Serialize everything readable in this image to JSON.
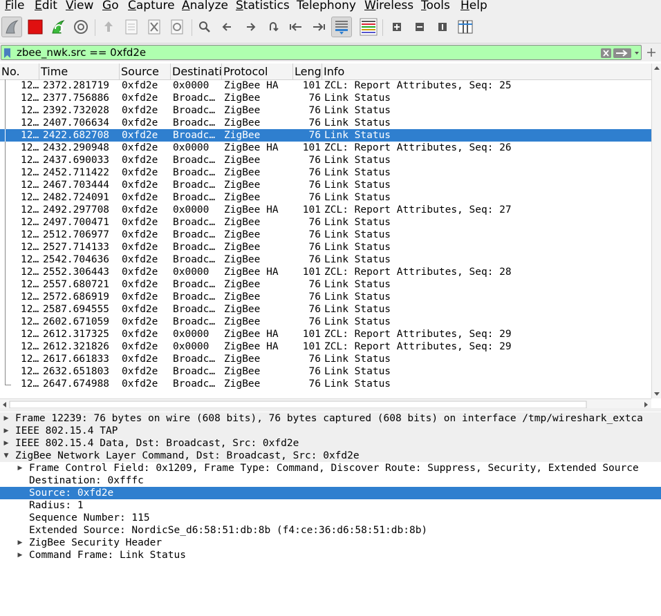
{
  "menu": [
    {
      "label": "File",
      "u": "F",
      "rest": "ile"
    },
    {
      "label": "Edit",
      "u": "E",
      "rest": "dit"
    },
    {
      "label": "View",
      "u": "V",
      "rest": "iew"
    },
    {
      "label": "Go",
      "u": "G",
      "rest": "o"
    },
    {
      "label": "Capture",
      "u": "C",
      "rest": "apture"
    },
    {
      "label": "Analyze",
      "u": "A",
      "rest": "nalyze"
    },
    {
      "label": "Statistics",
      "u": "S",
      "rest": "tatistics"
    },
    {
      "label": "Telephony",
      "u": "",
      "rest": "Telephony"
    },
    {
      "label": "Wireless",
      "u": "W",
      "rest": "ireless"
    },
    {
      "label": "Tools",
      "u": "T",
      "rest": "ools"
    },
    {
      "label": "Help",
      "u": "H",
      "rest": "elp"
    }
  ],
  "filter": {
    "value": "zbee_nwk.src == 0xfd2e"
  },
  "columns": {
    "no": "No.",
    "time": "Time",
    "source": "Source",
    "destination": "Destinati",
    "protocol": "Protocol",
    "length": "Leng",
    "info": "Info"
  },
  "packets": [
    {
      "no": "12…",
      "time": "2372.281719",
      "src": "0xfd2e",
      "dst": "0x0000",
      "proto": "ZigBee HA",
      "len": "101",
      "info": "ZCL: Report Attributes, Seq: 25"
    },
    {
      "no": "12…",
      "time": "2377.756886",
      "src": "0xfd2e",
      "dst": "Broadc…",
      "proto": "ZigBee",
      "len": "76",
      "info": "Link Status"
    },
    {
      "no": "12…",
      "time": "2392.732028",
      "src": "0xfd2e",
      "dst": "Broadc…",
      "proto": "ZigBee",
      "len": "76",
      "info": "Link Status"
    },
    {
      "no": "12…",
      "time": "2407.706634",
      "src": "0xfd2e",
      "dst": "Broadc…",
      "proto": "ZigBee",
      "len": "76",
      "info": "Link Status"
    },
    {
      "no": "12…",
      "time": "2422.682708",
      "src": "0xfd2e",
      "dst": "Broadc…",
      "proto": "ZigBee",
      "len": "76",
      "info": "Link Status",
      "selected": true
    },
    {
      "no": "12…",
      "time": "2432.290948",
      "src": "0xfd2e",
      "dst": "0x0000",
      "proto": "ZigBee HA",
      "len": "101",
      "info": "ZCL: Report Attributes, Seq: 26"
    },
    {
      "no": "12…",
      "time": "2437.690033",
      "src": "0xfd2e",
      "dst": "Broadc…",
      "proto": "ZigBee",
      "len": "76",
      "info": "Link Status"
    },
    {
      "no": "12…",
      "time": "2452.711422",
      "src": "0xfd2e",
      "dst": "Broadc…",
      "proto": "ZigBee",
      "len": "76",
      "info": "Link Status"
    },
    {
      "no": "12…",
      "time": "2467.703444",
      "src": "0xfd2e",
      "dst": "Broadc…",
      "proto": "ZigBee",
      "len": "76",
      "info": "Link Status"
    },
    {
      "no": "12…",
      "time": "2482.724091",
      "src": "0xfd2e",
      "dst": "Broadc…",
      "proto": "ZigBee",
      "len": "76",
      "info": "Link Status"
    },
    {
      "no": "12…",
      "time": "2492.297708",
      "src": "0xfd2e",
      "dst": "0x0000",
      "proto": "ZigBee HA",
      "len": "101",
      "info": "ZCL: Report Attributes, Seq: 27"
    },
    {
      "no": "12…",
      "time": "2497.700471",
      "src": "0xfd2e",
      "dst": "Broadc…",
      "proto": "ZigBee",
      "len": "76",
      "info": "Link Status"
    },
    {
      "no": "12…",
      "time": "2512.706977",
      "src": "0xfd2e",
      "dst": "Broadc…",
      "proto": "ZigBee",
      "len": "76",
      "info": "Link Status"
    },
    {
      "no": "12…",
      "time": "2527.714133",
      "src": "0xfd2e",
      "dst": "Broadc…",
      "proto": "ZigBee",
      "len": "76",
      "info": "Link Status"
    },
    {
      "no": "12…",
      "time": "2542.704636",
      "src": "0xfd2e",
      "dst": "Broadc…",
      "proto": "ZigBee",
      "len": "76",
      "info": "Link Status"
    },
    {
      "no": "12…",
      "time": "2552.306443",
      "src": "0xfd2e",
      "dst": "0x0000",
      "proto": "ZigBee HA",
      "len": "101",
      "info": "ZCL: Report Attributes, Seq: 28"
    },
    {
      "no": "12…",
      "time": "2557.680721",
      "src": "0xfd2e",
      "dst": "Broadc…",
      "proto": "ZigBee",
      "len": "76",
      "info": "Link Status"
    },
    {
      "no": "12…",
      "time": "2572.686919",
      "src": "0xfd2e",
      "dst": "Broadc…",
      "proto": "ZigBee",
      "len": "76",
      "info": "Link Status"
    },
    {
      "no": "12…",
      "time": "2587.694555",
      "src": "0xfd2e",
      "dst": "Broadc…",
      "proto": "ZigBee",
      "len": "76",
      "info": "Link Status"
    },
    {
      "no": "12…",
      "time": "2602.671059",
      "src": "0xfd2e",
      "dst": "Broadc…",
      "proto": "ZigBee",
      "len": "76",
      "info": "Link Status"
    },
    {
      "no": "12…",
      "time": "2612.317325",
      "src": "0xfd2e",
      "dst": "0x0000",
      "proto": "ZigBee HA",
      "len": "101",
      "info": "ZCL: Report Attributes, Seq: 29"
    },
    {
      "no": "12…",
      "time": "2612.321826",
      "src": "0xfd2e",
      "dst": "0x0000",
      "proto": "ZigBee HA",
      "len": "101",
      "info": "ZCL: Report Attributes, Seq: 29"
    },
    {
      "no": "12…",
      "time": "2617.661833",
      "src": "0xfd2e",
      "dst": "Broadc…",
      "proto": "ZigBee",
      "len": "76",
      "info": "Link Status"
    },
    {
      "no": "12…",
      "time": "2632.651803",
      "src": "0xfd2e",
      "dst": "Broadc…",
      "proto": "ZigBee",
      "len": "76",
      "info": "Link Status"
    },
    {
      "no": "12…",
      "time": "2647.674988",
      "src": "0xfd2e",
      "dst": "Broadc…",
      "proto": "ZigBee",
      "len": "76",
      "info": "Link Status"
    }
  ],
  "details": [
    {
      "text": "Frame 12239: 76 bytes on wire (608 bits), 76 bytes captured (608 bits) on interface /tmp/wireshark_extca",
      "level": 0,
      "arrow": "collapsed",
      "shade": true
    },
    {
      "text": "IEEE 802.15.4 TAP",
      "level": 0,
      "arrow": "collapsed",
      "shade": true
    },
    {
      "text": "IEEE 802.15.4 Data, Dst: Broadcast, Src: 0xfd2e",
      "level": 0,
      "arrow": "collapsed",
      "shade": true
    },
    {
      "text": "ZigBee Network Layer Command, Dst: Broadcast, Src: 0xfd2e",
      "level": 0,
      "arrow": "expanded",
      "shade": true
    },
    {
      "text": "Frame Control Field: 0x1209, Frame Type: Command, Discover Route: Suppress, Security, Extended Source",
      "level": 1,
      "arrow": "collapsed"
    },
    {
      "text": "Destination: 0xfffc",
      "level": 1,
      "arrow": "none"
    },
    {
      "text": "Source: 0xfd2e",
      "level": 1,
      "arrow": "none",
      "selected": true
    },
    {
      "text": "Radius: 1",
      "level": 1,
      "arrow": "none"
    },
    {
      "text": "Sequence Number: 115",
      "level": 1,
      "arrow": "none"
    },
    {
      "text": "Extended Source: NordicSe_d6:58:51:db:8b (f4:ce:36:d6:58:51:db:8b)",
      "level": 1,
      "arrow": "none"
    },
    {
      "text": "ZigBee Security Header",
      "level": 1,
      "arrow": "collapsed"
    },
    {
      "text": "Command Frame: Link Status",
      "level": 1,
      "arrow": "collapsed"
    }
  ],
  "colors": {
    "selection": "#2f7fcf",
    "filter_valid": "#afffaf",
    "stop_red": "#e01010",
    "fin_green": "#3cba3c"
  },
  "toolbar_icons": [
    "shark-fin-start-icon",
    "stop-capture-icon",
    "restart-capture-icon",
    "capture-options-icon",
    "open-file-icon",
    "save-file-icon",
    "close-file-icon",
    "reload-file-icon",
    "find-packet-icon",
    "go-back-icon",
    "go-forward-icon",
    "go-to-packet-icon",
    "go-first-icon",
    "go-last-icon",
    "auto-scroll-icon",
    "colorize-icon",
    "zoom-in-icon",
    "zoom-out-icon",
    "normal-size-icon",
    "resize-columns-icon"
  ]
}
